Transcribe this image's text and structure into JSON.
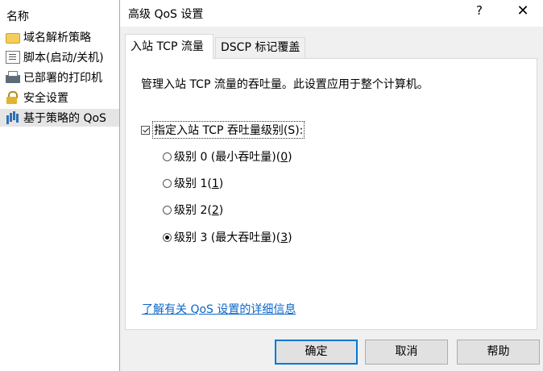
{
  "left_panel": {
    "header": "名称",
    "items": [
      {
        "label": "域名解析策略",
        "icon": "folder-icon"
      },
      {
        "label": "脚本(启动/关机)",
        "icon": "document-icon"
      },
      {
        "label": "已部署的打印机",
        "icon": "printer-icon"
      },
      {
        "label": "安全设置",
        "icon": "lock-icon"
      },
      {
        "label": "基于策略的 QoS",
        "icon": "bar-chart-icon",
        "selected": true
      }
    ]
  },
  "dialog": {
    "title": "高级 QoS 设置",
    "help_glyph": "?",
    "close_glyph": "✕",
    "tabs": [
      {
        "label": "入站 TCP 流量",
        "active": true
      },
      {
        "label": "DSCP 标记覆盖",
        "active": false
      }
    ],
    "description": "管理入站 TCP 流量的吞吐量。此设置应用于整个计算机。",
    "checkbox": {
      "label": "指定入站 TCP 吞吐量级别(S):",
      "checked": true
    },
    "radios": [
      {
        "label_pre": "级别 0 (最小吞吐量)(",
        "accel": "0",
        "label_post": ")",
        "selected": false
      },
      {
        "label_pre": "级别 1(",
        "accel": "1",
        "label_post": ")",
        "selected": false
      },
      {
        "label_pre": "级别 2(",
        "accel": "2",
        "label_post": ")",
        "selected": false
      },
      {
        "label_pre": "级别 3 (最大吞吐量)(",
        "accel": "3",
        "label_post": ")",
        "selected": true
      }
    ],
    "link": "了解有关 QoS 设置的详细信息",
    "buttons": {
      "ok": "确定",
      "cancel": "取消",
      "help": "帮助"
    }
  },
  "colors": {
    "link": "#0b66c8",
    "dialog_bg": "#f0f0f0",
    "default_button_border": "#0078d7"
  }
}
